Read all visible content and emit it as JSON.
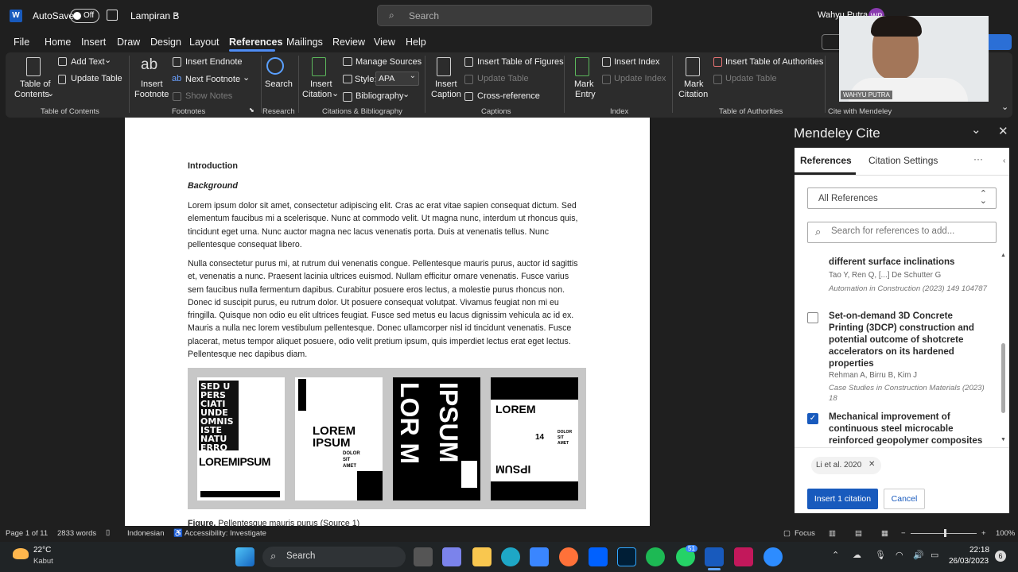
{
  "titlebar": {
    "autosave_label": "AutoSave",
    "autosave_state": "Off",
    "doc_name": "Lampiran B",
    "search_placeholder": "Search",
    "user_name": "Wahyu Putra",
    "user_initials": "WP"
  },
  "menu": [
    "File",
    "Home",
    "Insert",
    "Draw",
    "Design",
    "Layout",
    "References",
    "Mailings",
    "Review",
    "View",
    "Help"
  ],
  "ribbon": {
    "toc": {
      "btn": "Table of Contents",
      "btn1": "Table of",
      "btn2": "Contents",
      "add_text": "Add Text",
      "update_table": "Update Table",
      "group": "Table of Contents"
    },
    "footnotes": {
      "insert_footnote1": "Insert",
      "insert_footnote2": "Footnote",
      "insert_endnote": "Insert Endnote",
      "next_footnote": "Next Footnote",
      "show_notes": "Show Notes",
      "group": "Footnotes"
    },
    "research": {
      "search": "Search",
      "group": "Research"
    },
    "citations": {
      "insert_citation1": "Insert",
      "insert_citation2": "Citation",
      "manage_sources": "Manage Sources",
      "style_label": "Style:",
      "style_value": "APA",
      "bibliography": "Bibliography",
      "group": "Citations & Bibliography"
    },
    "captions": {
      "insert_caption1": "Insert",
      "insert_caption2": "Caption",
      "insert_tof": "Insert Table of Figures",
      "update_table": "Update Table",
      "cross_ref": "Cross-reference",
      "group": "Captions"
    },
    "index": {
      "mark_entry1": "Mark",
      "mark_entry2": "Entry",
      "insert_index": "Insert Index",
      "update_index": "Update Index",
      "group": "Index"
    },
    "toa": {
      "mark_citation1": "Mark",
      "mark_citation2": "Citation",
      "insert_toa": "Insert Table of Authorities",
      "update_table": "Update Table",
      "group": "Table of Authorities"
    },
    "mendeley": {
      "group": "Cite with Mendeley"
    }
  },
  "webcam": {
    "name_tag": "WAHYU PUTRA"
  },
  "document": {
    "heading": "Introduction",
    "subheading": "Background",
    "para1": "Lorem ipsum dolor sit amet, consectetur adipiscing elit. Cras ac erat vitae sapien consequat dictum. Sed elementum faucibus mi a scelerisque. Nunc at commodo velit. Ut magna nunc, interdum ut rhoncus quis, tincidunt eget urna. Nunc auctor magna nec lacus venenatis porta. Duis at venenatis tellus. Nunc pellentesque consequat libero.",
    "para2": "Nulla consectetur purus mi, at rutrum dui venenatis congue. Pellentesque mauris purus, auctor id sagittis et, venenatis a nunc. Praesent lacinia ultrices euismod. Nullam efficitur ornare venenatis. Fusce varius sem faucibus nulla fermentum dapibus. Curabitur posuere eros lectus, a molestie purus rhoncus non. Donec id suscipit purus, eu rutrum dolor. Ut posuere consequat volutpat. Vivamus feugiat non mi eu fringilla. Quisque non odio eu elit ultrices feugiat. Fusce sed metus eu lacus dignissim vehicula ac id ex. Mauris a nulla nec lorem vestibulum pellentesque. Donec ullamcorper nisl id tincidunt venenatis. Fusce placerat, metus tempor aliquet posuere, odio velit pretium ipsum, quis imperdiet lectus erat eget lectus. Pellentesque nec dapibus diam.",
    "caption_label": "Figure.",
    "caption_text": "Pellentesque mauris purus (Source 1)"
  },
  "mendeley": {
    "title": "Mendeley Cite",
    "tab_references": "References",
    "tab_settings": "Citation Settings",
    "more": "···",
    "filter_value": "All References",
    "search_placeholder": "Search for references to add...",
    "refs": [
      {
        "title": "different surface inclinations",
        "authors": "Tao Y, Ren Q, [...] De Schutter G",
        "journal": "Automation in Construction (2023) 149 104787",
        "checked": false
      },
      {
        "title": "Set-on-demand 3D Concrete Printing (3DCP) construction and potential outcome of shotcrete accelerators on its hardened properties",
        "authors": "Rehman A, Birru B, Kim J",
        "journal": "Case Studies in Construction Materials (2023) 18",
        "checked": false
      },
      {
        "title": "Mechanical improvement of continuous steel microcable reinforced geopolymer composites",
        "authors": "",
        "journal": "",
        "checked": true
      }
    ],
    "chip": "Li et al. 2020",
    "insert_btn": "Insert 1 citation",
    "cancel_btn": "Cancel"
  },
  "status": {
    "page": "Page 1 of 11",
    "words": "2833 words",
    "language": "Indonesian",
    "accessibility": "Accessibility: Investigate",
    "focus": "Focus",
    "zoom": "100%"
  },
  "taskbar": {
    "temp": "22°C",
    "weather": "Kabut",
    "search": "Search",
    "time": "22:18",
    "date": "26/03/2023",
    "whatsapp_badge": "51",
    "notif_count": "6"
  },
  "colors": {
    "accent": "#185abd",
    "word_blue": "#2b579a",
    "ribbon_bg": "#2c2c2c"
  }
}
